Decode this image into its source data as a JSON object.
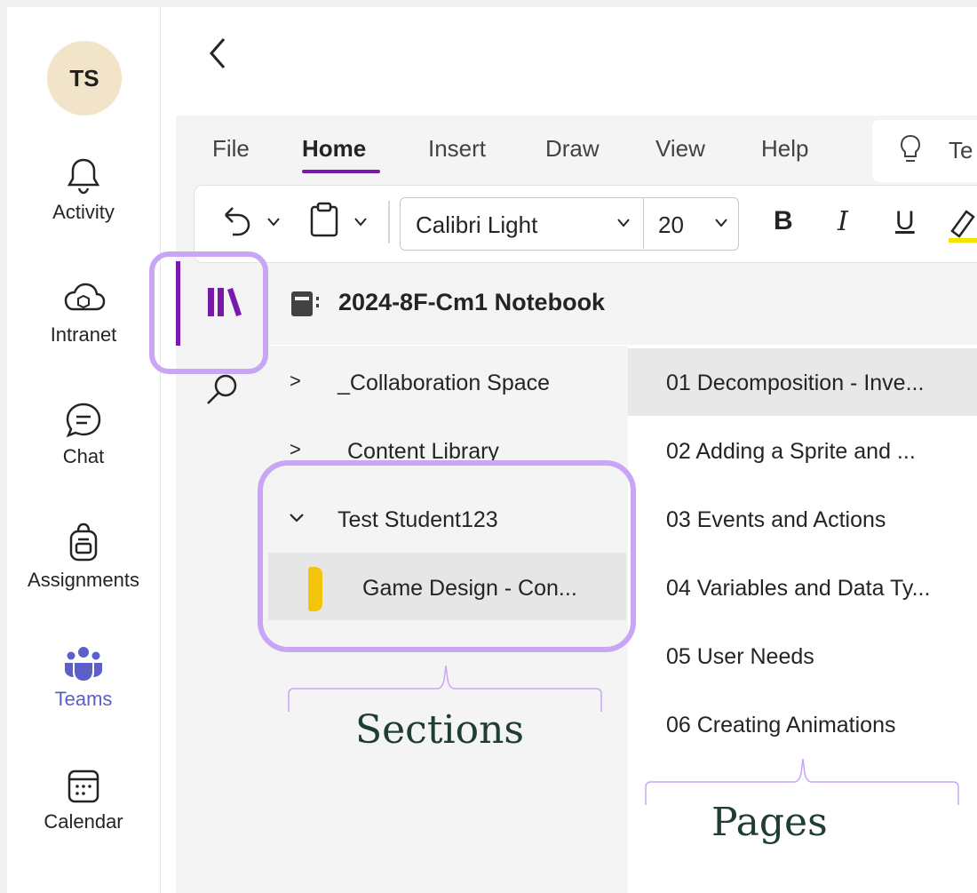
{
  "rail": {
    "avatar": "TS",
    "items": [
      {
        "label": "Activity",
        "icon": "bell-icon"
      },
      {
        "label": "Intranet",
        "icon": "cloud-icon"
      },
      {
        "label": "Chat",
        "icon": "chat-icon"
      },
      {
        "label": "Assignments",
        "icon": "backpack-icon"
      },
      {
        "label": "Teams",
        "icon": "teams-icon",
        "active": true
      },
      {
        "label": "Calendar",
        "icon": "calendar-icon"
      }
    ]
  },
  "ribbon": {
    "tabs": [
      "File",
      "Home",
      "Insert",
      "Draw",
      "View",
      "Help"
    ],
    "active_tab": "Home",
    "tell_me": "Te",
    "font_name": "Calibri Light",
    "font_size": "20",
    "bold": "B",
    "italic": "I",
    "underline": "U"
  },
  "notebook": {
    "title": "2024-8F-Cm1 Notebook",
    "sections": [
      {
        "label": "_Collaboration Space",
        "chevron": ">"
      },
      {
        "label": "Content Library",
        "chevron": ">"
      },
      {
        "label": "Test Student123",
        "chevron": "v"
      },
      {
        "label": "Game Design - Con...",
        "selected": true
      }
    ],
    "pages": [
      "01 Decomposition - Inve...",
      "02 Adding a Sprite and ...",
      "03 Events and Actions",
      "04 Variables and Data Ty...",
      "05 User Needs",
      "06 Creating Animations"
    ]
  },
  "annotations": {
    "sections_label": "Sections",
    "pages_label": "Pages"
  },
  "colors": {
    "accent": "#7719aa",
    "highlight": "#c9a6f5",
    "teams_active": "#5b5fc7",
    "section_tab": "#f2c40c",
    "label_text": "#1f3d33"
  }
}
